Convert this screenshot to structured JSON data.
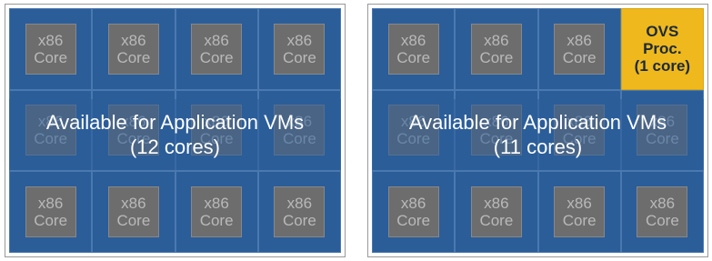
{
  "left_panel": {
    "core_label_line1": "x86",
    "core_label_line2": "Core",
    "overlay_line1": "Available for Application VMs",
    "overlay_line2": "(12 cores)"
  },
  "right_panel": {
    "core_label_line1": "x86",
    "core_label_line2": "Core",
    "ovs_line1": "OVS",
    "ovs_line2": "Proc.",
    "ovs_line3": "(1 core)",
    "overlay_line1": "Available for Application VMs",
    "overlay_line2": "(11 cores)"
  },
  "colors": {
    "cell_blue": "#2b5d99",
    "core_gray": "#6d6d6d",
    "ovs_yellow": "#efb81c"
  }
}
